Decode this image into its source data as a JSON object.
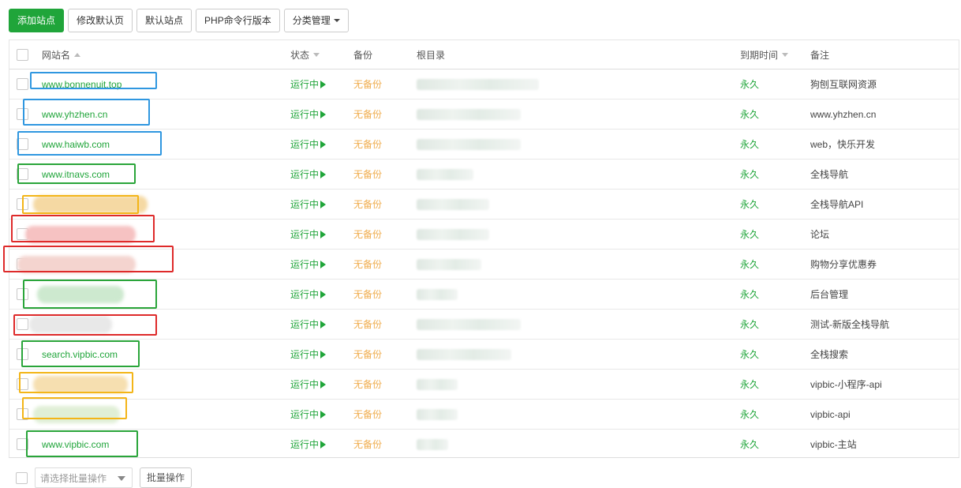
{
  "toolbar": {
    "add_site": "添加站点",
    "edit_default_page": "修改默认页",
    "default_site": "默认站点",
    "php_cli_version": "PHP命令行版本",
    "category_manage": "分类管理"
  },
  "table": {
    "headers": {
      "name": "网站名",
      "status": "状态",
      "backup": "备份",
      "root": "根目录",
      "expire": "到期时间",
      "note": "备注"
    },
    "rows": [
      {
        "name": "www.bonnenuit.top",
        "status": "运行中",
        "backup": "无备份",
        "expire": "永久",
        "note": "狗刨互联网资源",
        "highlight": "blue"
      },
      {
        "name": "www.yhzhen.cn",
        "status": "运行中",
        "backup": "无备份",
        "expire": "永久",
        "note": "www.yhzhen.cn",
        "highlight": "blue"
      },
      {
        "name": "www.haiwb.com",
        "status": "运行中",
        "backup": "无备份",
        "expire": "永久",
        "note": "web，快乐开发",
        "highlight": "blue"
      },
      {
        "name": "www.itnavs.com",
        "status": "运行中",
        "backup": "无备份",
        "expire": "永久",
        "note": "全栈导航",
        "highlight": "green"
      },
      {
        "name": "",
        "status": "运行中",
        "backup": "无备份",
        "expire": "永久",
        "note": "全栈导航API",
        "highlight": "yellow"
      },
      {
        "name": "",
        "status": "运行中",
        "backup": "无备份",
        "expire": "永久",
        "note": "论坛",
        "highlight": "red"
      },
      {
        "name": "",
        "status": "运行中",
        "backup": "无备份",
        "expire": "永久",
        "note": "购物分享优惠券",
        "highlight": "red"
      },
      {
        "name": "",
        "status": "运行中",
        "backup": "无备份",
        "expire": "永久",
        "note": "后台管理",
        "highlight": "green"
      },
      {
        "name": "",
        "status": "运行中",
        "backup": "无备份",
        "expire": "永久",
        "note": "测试-新版全栈导航",
        "highlight": "red"
      },
      {
        "name": "search.vipbic.com",
        "status": "运行中",
        "backup": "无备份",
        "expire": "永久",
        "note": "全栈搜索",
        "highlight": "green"
      },
      {
        "name": "",
        "status": "运行中",
        "backup": "无备份",
        "expire": "永久",
        "note": "vipbic-小程序-api",
        "highlight": "yellow"
      },
      {
        "name": "",
        "status": "运行中",
        "backup": "无备份",
        "expire": "永久",
        "note": "vipbic-api",
        "highlight": "yellow"
      },
      {
        "name": "www.vipbic.com",
        "status": "运行中",
        "backup": "无备份",
        "expire": "永久",
        "note": "vipbic-主站",
        "highlight": "green"
      }
    ]
  },
  "footer": {
    "batch_select_placeholder": "请选择批量操作",
    "batch_button": "批量操作"
  },
  "colors": {
    "brand_green": "#20a53a",
    "backup_orange": "#f0ad4e",
    "highlight_blue": "#2f97e0",
    "highlight_green": "#2aa53a",
    "highlight_red": "#de2a2a",
    "highlight_yellow": "#f3b518"
  }
}
